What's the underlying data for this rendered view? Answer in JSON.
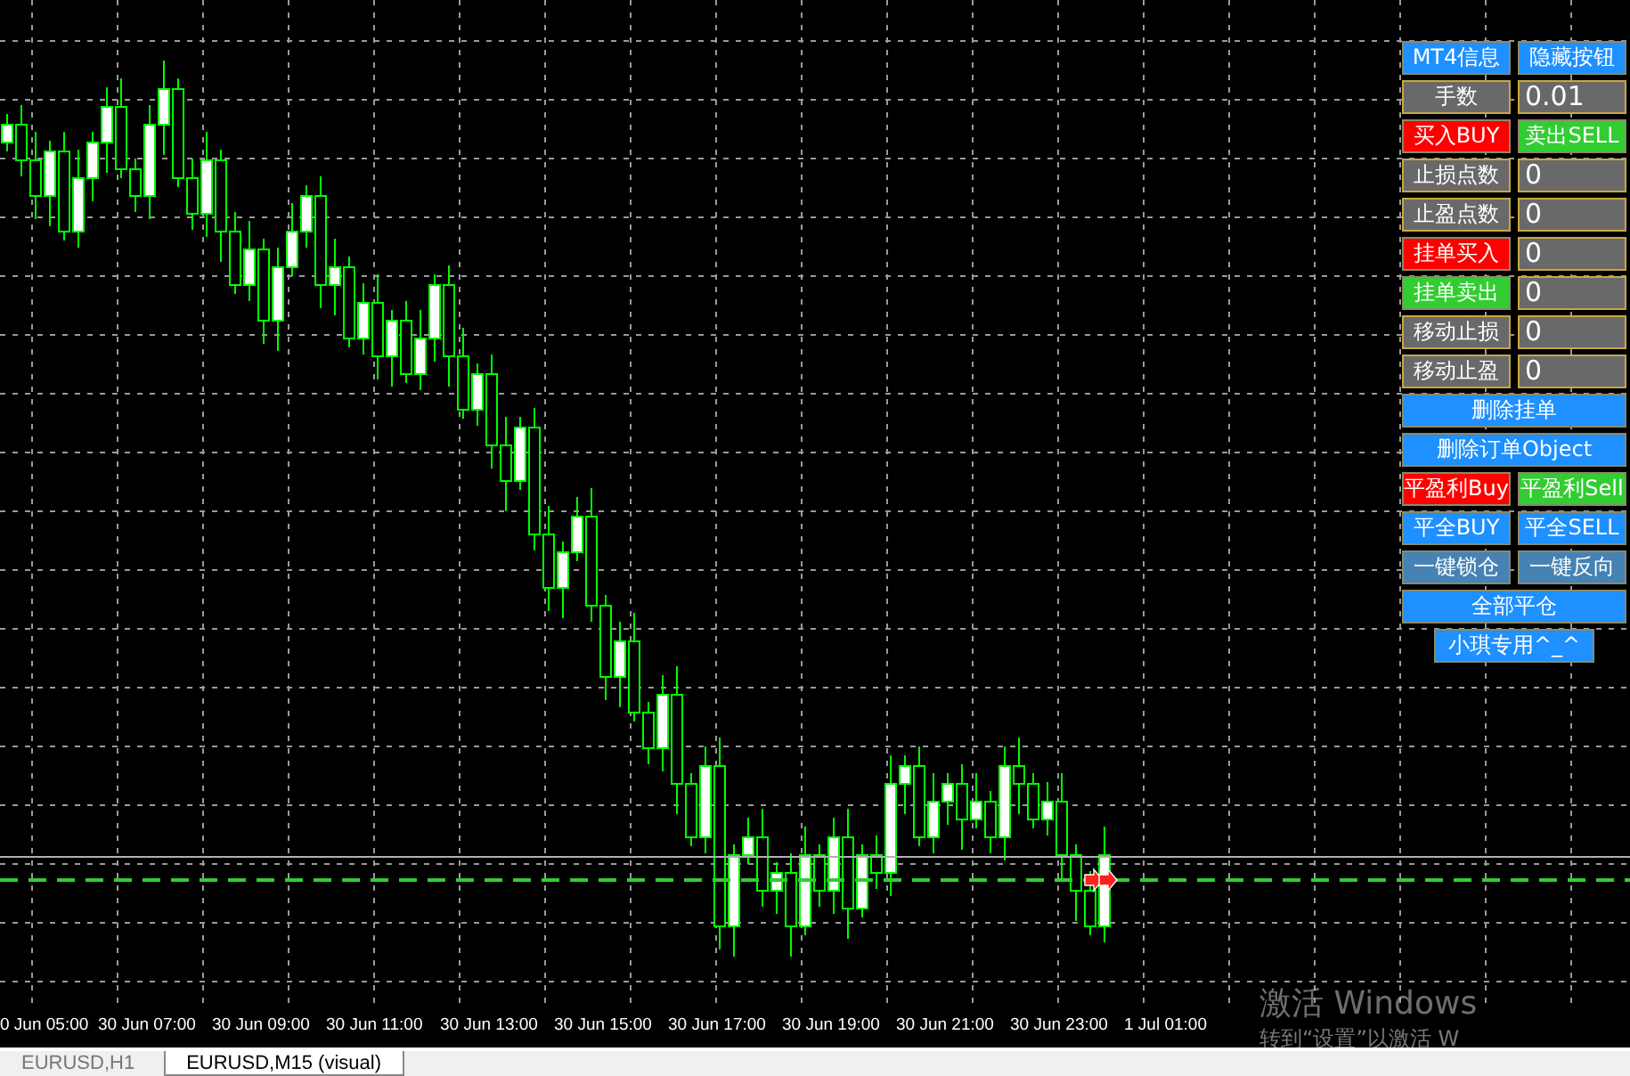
{
  "chart": {
    "kind": "candlestick"
  },
  "panel": {
    "rows": [
      [
        {
          "kind": "button",
          "text": "MT4信息",
          "color": "#1e90ff"
        },
        {
          "kind": "button",
          "text": "隐藏按钮",
          "color": "#1e90ff"
        }
      ],
      [
        {
          "kind": "label",
          "text": "手数",
          "color": "#696969"
        },
        {
          "kind": "field",
          "text": "0.01",
          "color": "#696969"
        }
      ],
      [
        {
          "kind": "button",
          "text": "买入BUY",
          "color": "#ff0000"
        },
        {
          "kind": "button",
          "text": "卖出SELL",
          "color": "#32cd32"
        }
      ],
      [
        {
          "kind": "label",
          "text": "止损点数",
          "color": "#696969"
        },
        {
          "kind": "field",
          "text": "0",
          "color": "#696969"
        }
      ],
      [
        {
          "kind": "label",
          "text": "止盈点数",
          "color": "#696969"
        },
        {
          "kind": "field",
          "text": "0",
          "color": "#696969"
        }
      ],
      [
        {
          "kind": "button",
          "text": "挂单买入",
          "color": "#ff0000"
        },
        {
          "kind": "field",
          "text": "0",
          "color": "#696969"
        }
      ],
      [
        {
          "kind": "button",
          "text": "挂单卖出",
          "color": "#32cd32"
        },
        {
          "kind": "field",
          "text": "0",
          "color": "#696969"
        }
      ],
      [
        {
          "kind": "label",
          "text": "移动止损",
          "color": "#696969"
        },
        {
          "kind": "field",
          "text": "0",
          "color": "#696969"
        }
      ],
      [
        {
          "kind": "label",
          "text": "移动止盈",
          "color": "#696969"
        },
        {
          "kind": "field",
          "text": "0",
          "color": "#696969"
        }
      ],
      [
        {
          "kind": "wide",
          "text": "删除挂单",
          "color": "#1e90ff"
        }
      ],
      [
        {
          "kind": "wide",
          "text": "删除订单Object",
          "color": "#1e90ff"
        }
      ],
      [
        {
          "kind": "button",
          "text": "平盈利Buy",
          "color": "#ff0000"
        },
        {
          "kind": "button",
          "text": "平盈利Sell",
          "color": "#32cd32"
        }
      ],
      [
        {
          "kind": "button",
          "text": "平全BUY",
          "color": "#1e90ff"
        },
        {
          "kind": "button",
          "text": "平全SELL",
          "color": "#1e90ff"
        }
      ],
      [
        {
          "kind": "button",
          "text": "一键锁仓",
          "color": "#4682b4"
        },
        {
          "kind": "button",
          "text": "一键反向",
          "color": "#4682b4"
        }
      ],
      [
        {
          "kind": "wide",
          "text": "全部平仓",
          "color": "#1e90ff"
        }
      ],
      [
        {
          "kind": "narrow",
          "text": "小琪专用^_^",
          "color": "#1e90ff"
        }
      ]
    ]
  },
  "time_axis": [
    "0 Jun 05:00",
    "30 Jun 07:00",
    "30 Jun 09:00",
    "30 Jun 11:00",
    "30 Jun 13:00",
    "30 Jun 15:00",
    "30 Jun 17:00",
    "30 Jun 19:00",
    "30 Jun 21:00",
    "30 Jun 23:00",
    "1 Jul 01:00"
  ],
  "os_notice": {
    "title": "激活 Windows",
    "text": "转到“设置”以激活 W"
  },
  "tabs": [
    {
      "label": "EURUSD,H1",
      "selected": false
    },
    {
      "label": "EURUSD,M15 (visual)",
      "selected": true
    }
  ]
}
